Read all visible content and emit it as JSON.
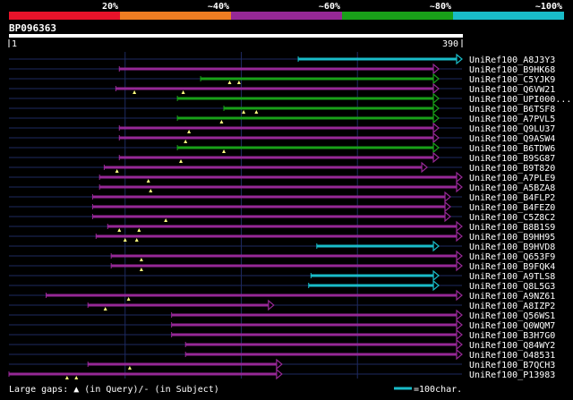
{
  "legend": {
    "bands": [
      {
        "label": "20%",
        "color": "#e8132a"
      },
      {
        "label": "~40%",
        "color": "#ee7d22"
      },
      {
        "label": "~60%",
        "color": "#962896"
      },
      {
        "label": "~80%",
        "color": "#19a019"
      },
      {
        "label": "~100%",
        "color": "#19bcc8"
      }
    ]
  },
  "query": {
    "name": "BP096363",
    "start": "1",
    "end": "390",
    "length": 390
  },
  "footer": {
    "gaps_text": "Large gaps: ▲ (in Query)/- (in Subject)",
    "scale_text": "=100char."
  },
  "colors": {
    "purple": "#962896",
    "green": "#19a019",
    "cyan": "#19bcc8",
    "gap": "#ffff80",
    "grid": "#1e2a60"
  },
  "chart_data": {
    "type": "alignment",
    "hits": [
      {
        "name": "UniRef100_A8J3Y3",
        "start": 249,
        "end": 390,
        "color": "cyan",
        "gaps": []
      },
      {
        "name": "UniRef100_B9HK68",
        "start": 95,
        "end": 370,
        "color": "purple",
        "gaps": []
      },
      {
        "name": "UniRef100_C5YJK9",
        "start": 165,
        "end": 370,
        "color": "green",
        "gaps": [
          190,
          198
        ]
      },
      {
        "name": "UniRef100_Q6VW21",
        "start": 92,
        "end": 370,
        "color": "purple",
        "gaps": [
          108,
          150
        ]
      },
      {
        "name": "UniRef100_UPI000...",
        "start": 145,
        "end": 370,
        "color": "green",
        "gaps": []
      },
      {
        "name": "UniRef100_B6TSF8",
        "start": 185,
        "end": 370,
        "color": "green",
        "gaps": [
          202,
          213
        ]
      },
      {
        "name": "UniRef100_A7PVL5",
        "start": 145,
        "end": 370,
        "color": "green",
        "gaps": [
          183
        ]
      },
      {
        "name": "UniRef100_Q9LU37",
        "start": 95,
        "end": 370,
        "color": "purple",
        "gaps": [
          155
        ]
      },
      {
        "name": "UniRef100_Q9ASW4",
        "start": 95,
        "end": 370,
        "color": "purple",
        "gaps": [
          152
        ]
      },
      {
        "name": "UniRef100_B6TDW6",
        "start": 145,
        "end": 370,
        "color": "green",
        "gaps": [
          185
        ]
      },
      {
        "name": "UniRef100_B9SG87",
        "start": 95,
        "end": 370,
        "color": "purple",
        "gaps": [
          148
        ]
      },
      {
        "name": "UniRef100_B9T820",
        "start": 82,
        "end": 360,
        "color": "purple",
        "gaps": [
          93
        ]
      },
      {
        "name": "UniRef100_A7PLE9",
        "start": 78,
        "end": 390,
        "color": "purple",
        "gaps": [
          120
        ]
      },
      {
        "name": "UniRef100_A5BZA8",
        "start": 78,
        "end": 390,
        "color": "purple",
        "gaps": [
          122
        ]
      },
      {
        "name": "UniRef100_B4FLP2",
        "start": 72,
        "end": 380,
        "color": "purple",
        "gaps": []
      },
      {
        "name": "UniRef100_B4FEZ0",
        "start": 72,
        "end": 380,
        "color": "purple",
        "gaps": []
      },
      {
        "name": "UniRef100_C5Z8C2",
        "start": 72,
        "end": 380,
        "color": "purple",
        "gaps": [
          135
        ]
      },
      {
        "name": "UniRef100_B8B1S9",
        "start": 85,
        "end": 390,
        "color": "purple",
        "gaps": [
          95,
          112
        ]
      },
      {
        "name": "UniRef100_B9HH95",
        "start": 75,
        "end": 390,
        "color": "purple",
        "gaps": [
          100,
          110
        ]
      },
      {
        "name": "UniRef100_B9HVD8",
        "start": 265,
        "end": 370,
        "color": "cyan",
        "gaps": []
      },
      {
        "name": "UniRef100_Q653F9",
        "start": 88,
        "end": 390,
        "color": "purple",
        "gaps": [
          114
        ]
      },
      {
        "name": "UniRef100_B9FQK4",
        "start": 88,
        "end": 390,
        "color": "purple",
        "gaps": [
          114
        ]
      },
      {
        "name": "UniRef100_A9TLS8",
        "start": 260,
        "end": 370,
        "color": "cyan",
        "gaps": []
      },
      {
        "name": "UniRef100_Q8L5G3",
        "start": 258,
        "end": 370,
        "color": "cyan",
        "gaps": []
      },
      {
        "name": "UniRef100_A9NZ61",
        "start": 32,
        "end": 390,
        "color": "purple",
        "gaps": [
          103
        ]
      },
      {
        "name": "UniRef100_A8IZP2",
        "start": 68,
        "end": 228,
        "color": "purple",
        "gaps": [
          83
        ]
      },
      {
        "name": "UniRef100_Q56WS1",
        "start": 140,
        "end": 390,
        "color": "purple",
        "gaps": []
      },
      {
        "name": "UniRef100_Q0WQM7",
        "start": 140,
        "end": 390,
        "color": "purple",
        "gaps": []
      },
      {
        "name": "UniRef100_B3H7G0",
        "start": 140,
        "end": 390,
        "color": "purple",
        "gaps": []
      },
      {
        "name": "UniRef100_Q84WY2",
        "start": 152,
        "end": 390,
        "color": "purple",
        "gaps": []
      },
      {
        "name": "UniRef100_O48531",
        "start": 152,
        "end": 390,
        "color": "purple",
        "gaps": []
      },
      {
        "name": "UniRef100_B7QCH3",
        "start": 68,
        "end": 235,
        "color": "purple",
        "gaps": [
          104
        ]
      },
      {
        "name": "UniRef100_P13983",
        "start": 0,
        "end": 235,
        "color": "purple",
        "gaps": [
          50,
          58
        ]
      }
    ]
  }
}
